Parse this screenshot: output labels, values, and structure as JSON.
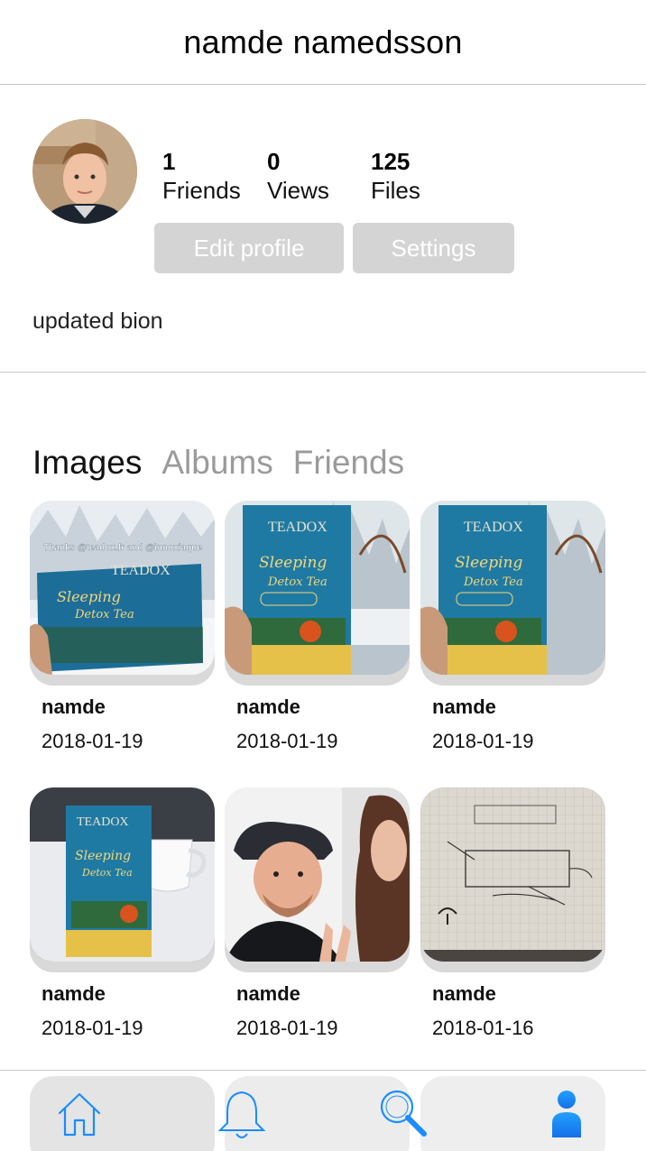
{
  "header": {
    "title": "namde namedsson"
  },
  "profile": {
    "stats": [
      {
        "value": "1",
        "label": "Friends"
      },
      {
        "value": "0",
        "label": "Views"
      },
      {
        "value": "125",
        "label": "Files"
      }
    ],
    "edit_label": "Edit profile",
    "settings_label": "Settings",
    "bio": "updated bion"
  },
  "tabs": [
    {
      "label": "Images",
      "active": true
    },
    {
      "label": "Albums",
      "active": false
    },
    {
      "label": "Friends",
      "active": false
    }
  ],
  "images": [
    {
      "user": "namde",
      "date": "2018-01-19",
      "caption": "Thanks @teadox.fr and @innoxiaque"
    },
    {
      "user": "namde",
      "date": "2018-01-19"
    },
    {
      "user": "namde",
      "date": "2018-01-19"
    },
    {
      "user": "namde",
      "date": "2018-01-19"
    },
    {
      "user": "namde",
      "date": "2018-01-19"
    },
    {
      "user": "namde",
      "date": "2018-01-16"
    }
  ],
  "product": {
    "brand": "TEADOX",
    "name1": "Sleeping",
    "name2": "Detox Tea"
  },
  "tabbar": {
    "items": [
      {
        "icon": "home-icon"
      },
      {
        "icon": "bell-icon"
      },
      {
        "icon": "search-icon"
      },
      {
        "icon": "profile-icon"
      }
    ],
    "accent": "#1a8cff"
  }
}
